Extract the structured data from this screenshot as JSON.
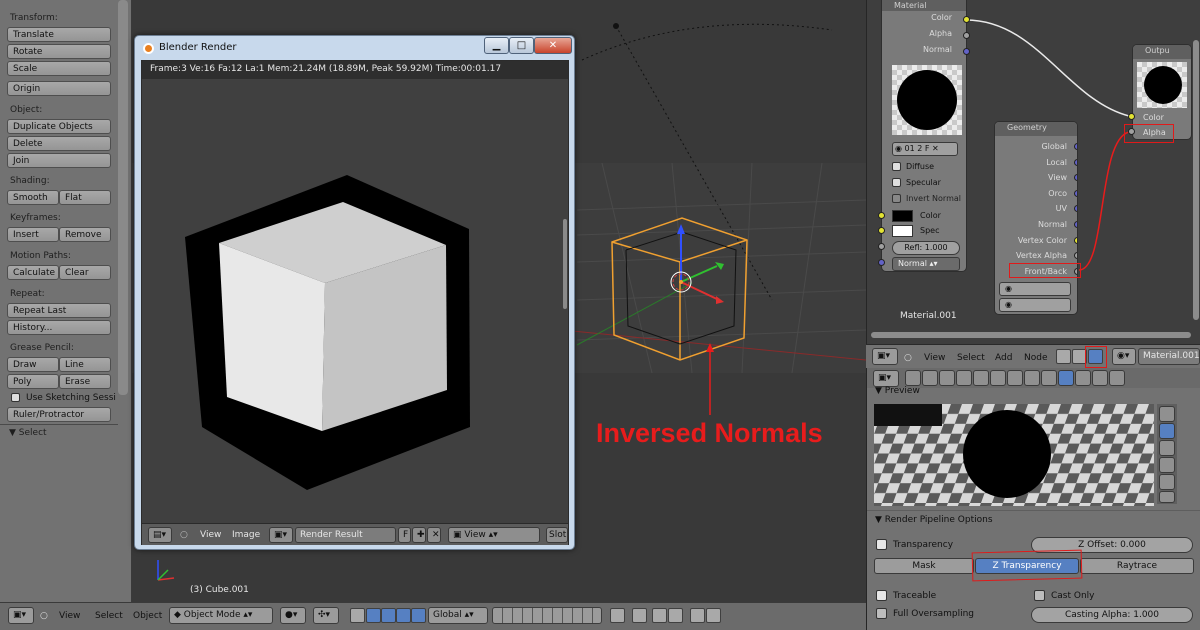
{
  "toolshelf": {
    "transform_label": "Transform:",
    "translate": "Translate",
    "rotate": "Rotate",
    "scale": "Scale",
    "origin": "Origin",
    "object_label": "Object:",
    "duplicate": "Duplicate Objects",
    "delete": "Delete",
    "join": "Join",
    "shading_label": "Shading:",
    "smooth": "Smooth",
    "flat": "Flat",
    "keyframes_label": "Keyframes:",
    "insert": "Insert",
    "remove": "Remove",
    "motion_label": "Motion Paths:",
    "calculate": "Calculate",
    "clear": "Clear",
    "repeat_label": "Repeat:",
    "repeat_last": "Repeat Last",
    "history": "History...",
    "grease_label": "Grease Pencil:",
    "draw": "Draw",
    "line": "Line",
    "poly": "Poly",
    "erase": "Erase",
    "sketching": "Use Sketching Sessi",
    "ruler": "Ruler/Protractor",
    "select_panel": "Select"
  },
  "render_window": {
    "title": "Blender Render",
    "info": "Frame:3 Ve:16 Fa:12 La:1 Mem:21.24M (18.89M, Peak 59.92M) Time:00:01.17",
    "minimize": "▁",
    "maximize": "□",
    "close": "✕",
    "footer_view": "View",
    "footer_image": "Image",
    "image_name": "Render Result",
    "fake_user": "F",
    "view_select": "View",
    "slot": "Slot"
  },
  "viewport": {
    "annotation": "Inversed Normals",
    "object_label": "(3) Cube.001"
  },
  "bottom_bar": {
    "view": "View",
    "select": "Select",
    "object": "Object",
    "mode": "Object Mode",
    "orientation": "Global"
  },
  "node_editor": {
    "material_node": {
      "title": "Material",
      "color": "Color",
      "alpha": "Alpha",
      "normal": "Normal",
      "slot_num": "01",
      "users": "2",
      "fake": "F",
      "diffuse": "Diffuse",
      "specular": "Specular",
      "invert_normal": "Invert Normal",
      "color_in": "Color",
      "spec_in": "Spec",
      "refl": "Refl: 1.000",
      "normal_in": "Normal"
    },
    "output_node": {
      "title": "Outpu",
      "color": "Color",
      "alpha": "Alpha"
    },
    "geometry_node": {
      "title": "Geometry",
      "outputs": [
        "Global",
        "Local",
        "View",
        "Orco",
        "UV",
        "Normal",
        "Vertex Color",
        "Vertex Alpha",
        "Front/Back"
      ]
    },
    "material_name": "Material.001"
  },
  "node_header": {
    "view": "View",
    "select": "Select",
    "add": "Add",
    "node": "Node",
    "material": "Material.001"
  },
  "properties": {
    "preview_label": "Preview",
    "pipeline_title": "Render Pipeline Options",
    "transparency": "Transparency",
    "z_offset": "Z Offset: 0.000",
    "mask": "Mask",
    "z_transparency": "Z Transparency",
    "raytrace": "Raytrace",
    "traceable": "Traceable",
    "cast_only": "Cast Only",
    "full_oversampling": "Full Oversampling",
    "casting_alpha": "Casting Alpha: 1.000"
  },
  "colors": {
    "annotation_red": "#e81c1c",
    "selected_orange": "#f0a030",
    "active_blue": "#5680c2"
  }
}
